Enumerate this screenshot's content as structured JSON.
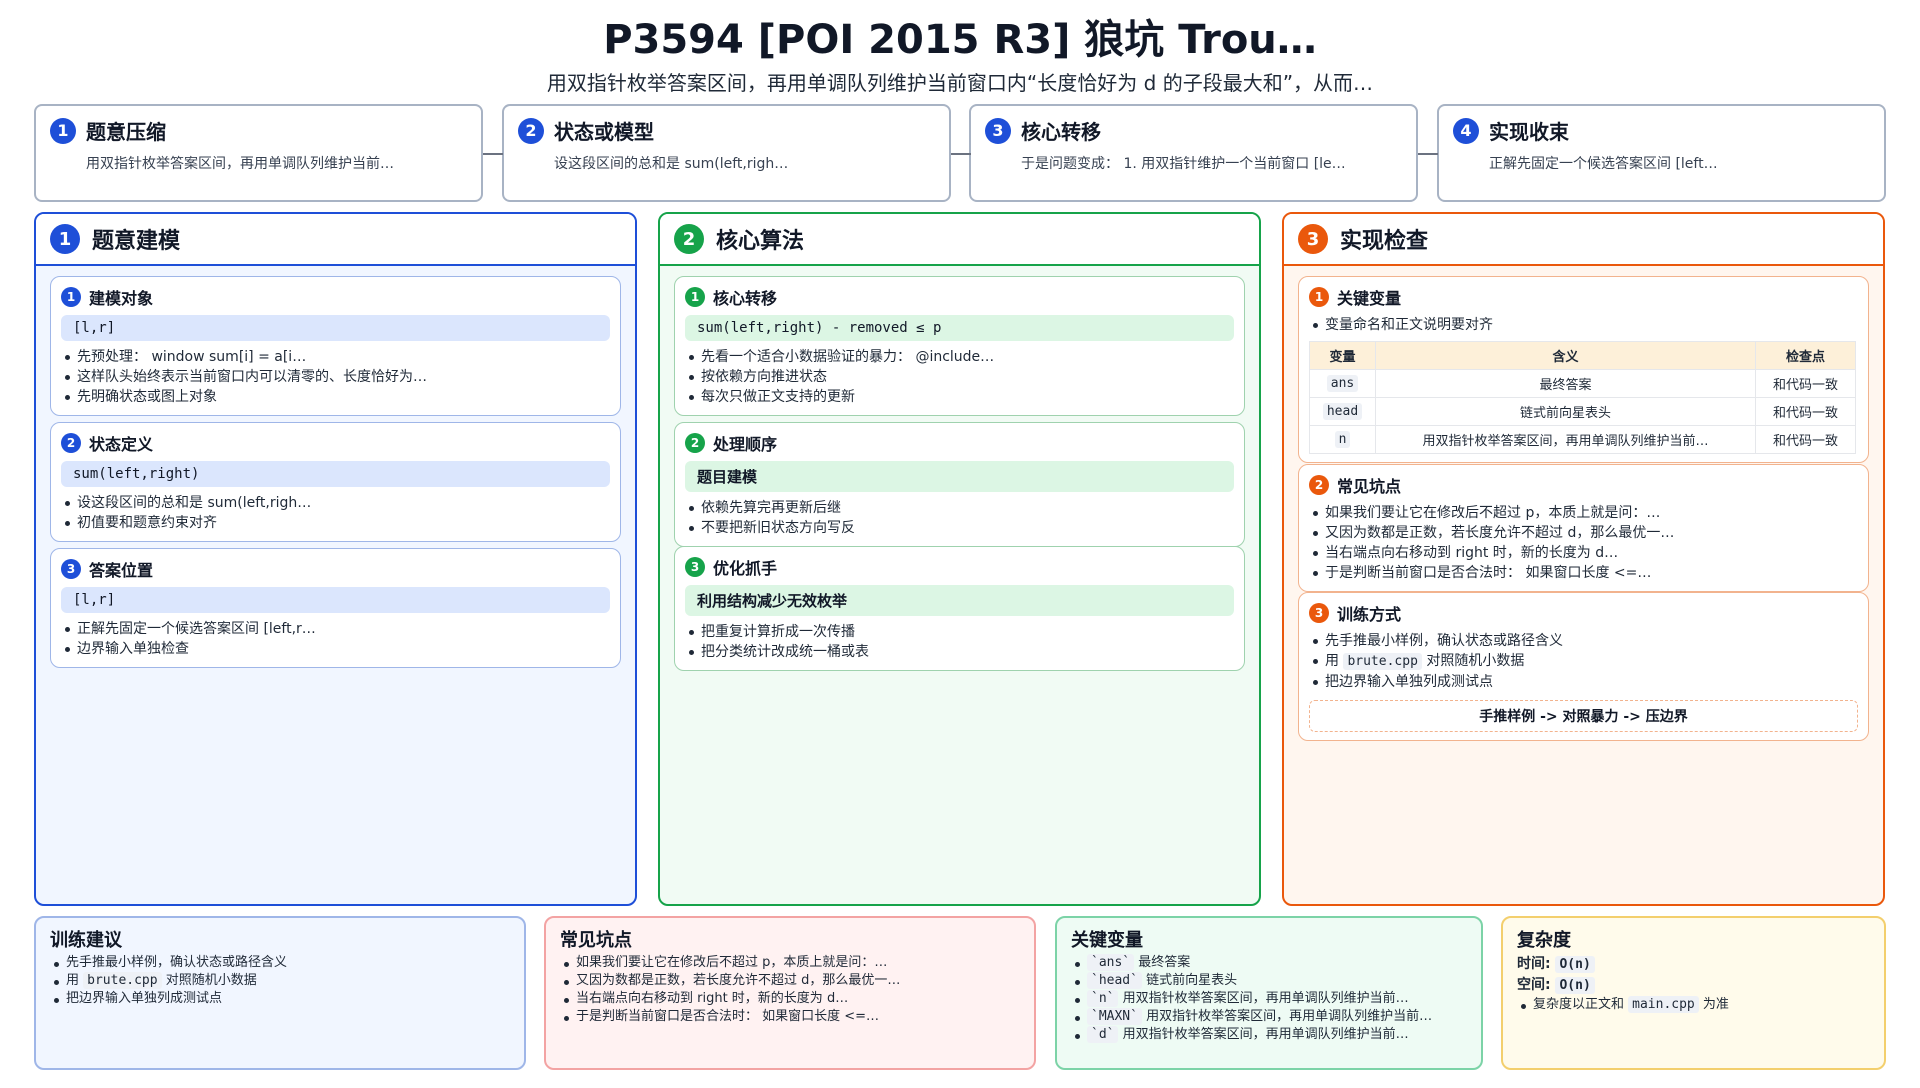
{
  "header": {
    "title": "P3594 [POI 2015 R3] 狼坑 Trou…",
    "subtitle": "用双指针枚举答案区间，再用单调队列维护当前窗口内“长度恰好为 d 的子段最大和”，从而…"
  },
  "flow": [
    {
      "num": "1",
      "title": "题意压缩",
      "desc": "用双指针枚举答案区间，再用单调队列维护当前…"
    },
    {
      "num": "2",
      "title": "状态或模型",
      "desc": "设这段区间的总和是 sum(left,righ…"
    },
    {
      "num": "3",
      "title": "核心转移",
      "desc": "于是问题变成： 1. 用双指针维护一个当前窗口 [le…"
    },
    {
      "num": "4",
      "title": "实现收束",
      "desc": "正解先固定一个候选答案区间 [left…"
    }
  ],
  "col1": {
    "num": "1",
    "title": "题意建模",
    "cards": [
      {
        "num": "1",
        "title": "建模对象",
        "formula": "[l,r]",
        "items": [
          "先预处理： window sum[i] = a[i…",
          "这样队头始终表示当前窗口内可以清零的、长度恰好为…",
          "先明确状态或图上对象"
        ]
      },
      {
        "num": "2",
        "title": "状态定义",
        "formula": "sum(left,right)",
        "items": [
          "设这段区间的总和是 sum(left,righ…",
          "初值要和题意约束对齐"
        ]
      },
      {
        "num": "3",
        "title": "答案位置",
        "formula": "[l,r]",
        "items": [
          "正解先固定一个候选答案区间 [left,r…",
          "边界输入单独检查"
        ]
      }
    ]
  },
  "col2": {
    "num": "2",
    "title": "核心算法",
    "cards": [
      {
        "num": "1",
        "title": "核心转移",
        "formula": "sum(left,right) - removed  ≤  p",
        "items": [
          "先看一个适合小数据验证的暴力： @include…",
          "按依赖方向推进状态",
          "每次只做正文支持的更新"
        ]
      },
      {
        "num": "2",
        "title": "处理顺序",
        "formula": "题目建模",
        "items": [
          "依赖先算完再更新后继",
          "不要把新旧状态方向写反"
        ]
      },
      {
        "num": "3",
        "title": "优化抓手",
        "formula": "利用结构减少无效枚举",
        "items": [
          "把重复计算折成一次传播",
          "把分类统计改成统一桶或表"
        ]
      }
    ]
  },
  "col3": {
    "num": "3",
    "title": "实现检查",
    "vars_card": {
      "num": "1",
      "title": "关键变量",
      "note": "变量命名和正文说明要对齐",
      "headers": [
        "变量",
        "含义",
        "检查点"
      ],
      "rows": [
        {
          "name": "ans",
          "meaning": "最终答案",
          "check": "和代码一致"
        },
        {
          "name": "head",
          "meaning": "链式前向星表头",
          "check": "和代码一致"
        },
        {
          "name": "n",
          "meaning": "用双指针枚举答案区间，再用单调队列维护当前…",
          "check": "和代码一致"
        }
      ]
    },
    "pitfalls_card": {
      "num": "2",
      "title": "常见坑点",
      "items": [
        "如果我们要让它在修改后不超过 p，本质上就是问：…",
        "又因为数都是正数，若长度允许不超过 d，那么最优一…",
        "当右端点向右移动到 right 时，新的长度为 d…",
        "于是判断当前窗口是否合法时： 如果窗口长度 <=…"
      ]
    },
    "training_card": {
      "num": "3",
      "title": "训练方式",
      "item1": "先手推最小样例，确认状态或路径含义",
      "item2_pre": "用 ",
      "item2_code": "brute.cpp",
      "item2_post": " 对照随机小数据",
      "item3": "把边界输入单独列成测试点",
      "banner": "手推样例 -> 对照暴力 -> 压边界"
    }
  },
  "bottom": {
    "training": {
      "title": "训练建议",
      "item1": "先手推最小样例，确认状态或路径含义",
      "item2_pre": "用 ",
      "item2_code": "brute.cpp",
      "item2_post": " 对照随机小数据",
      "item3": "把边界输入单独列成测试点"
    },
    "pitfalls": {
      "title": "常见坑点",
      "items": [
        "如果我们要让它在修改后不超过 p，本质上就是问：…",
        "又因为数都是正数，若长度允许不超过 d，那么最优一…",
        "当右端点向右移动到 right 时，新的长度为 d…",
        "于是判断当前窗口是否合法时： 如果窗口长度 <=…"
      ]
    },
    "vars": {
      "title": "关键变量",
      "items": [
        {
          "code": "`ans`",
          "text": " 最终答案"
        },
        {
          "code": "`head`",
          "text": " 链式前向星表头"
        },
        {
          "code": "`n`",
          "text": " 用双指针枚举答案区间，再用单调队列维护当前…"
        },
        {
          "code": "`MAXN`",
          "text": " 用双指针枚举答案区间，再用单调队列维护当前…"
        },
        {
          "code": "`d`",
          "text": " 用双指针枚举答案区间，再用单调队列维护当前…"
        }
      ]
    },
    "complexity": {
      "title": "复杂度",
      "time_label": "时间: ",
      "time_val": "O(n)",
      "space_label": "空间: ",
      "space_val": "O(n)",
      "note_pre": "复杂度以正文和 ",
      "note_code": "main.cpp",
      "note_post": " 为准"
    }
  }
}
